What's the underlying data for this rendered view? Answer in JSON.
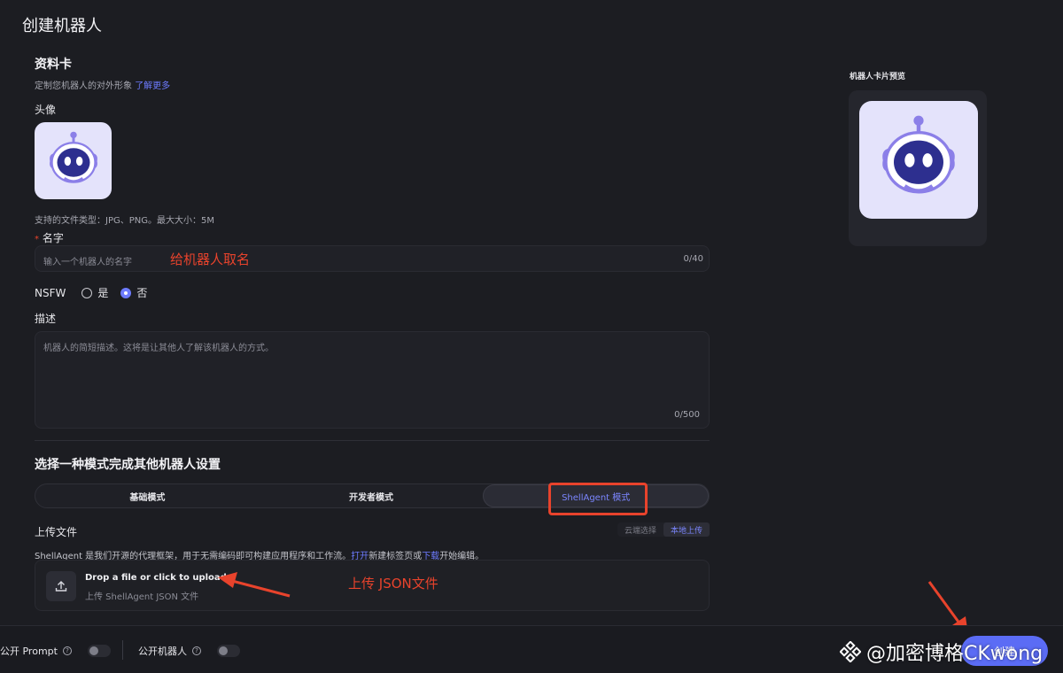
{
  "page": {
    "title": "创建机器人"
  },
  "profile": {
    "title": "资料卡",
    "subtitle": "定制您机器人的对外形象",
    "learn_more": "了解更多",
    "avatar_label": "头像",
    "file_hint": "支持的文件类型：JPG、PNG。最大大小：5M"
  },
  "name_field": {
    "required_mark": "*",
    "label": "名字",
    "placeholder": "输入一个机器人的名字",
    "counter": "0/40"
  },
  "nsfw": {
    "label": "NSFW",
    "options": [
      {
        "label": "是",
        "selected": false
      },
      {
        "label": "否",
        "selected": true
      }
    ]
  },
  "description": {
    "label": "描述",
    "placeholder": "机器人的简短描述。这将是让其他人了解该机器人的方式。",
    "counter": "0/500"
  },
  "mode": {
    "title": "选择一种模式完成其他机器人设置",
    "tabs": [
      {
        "label": "基础模式",
        "active": false
      },
      {
        "label": "开发者模式",
        "active": false
      },
      {
        "label": "ShellAgent 模式",
        "active": true
      }
    ]
  },
  "upload": {
    "label": "上传文件",
    "source_options": [
      {
        "label": "云端选择",
        "active": false
      },
      {
        "label": "本地上传",
        "active": true
      }
    ],
    "desc_prefix": "ShellAgent 是我们开源的代理框架，用于无需编码即可构建应用程序和工作流。",
    "desc_open": "打开",
    "desc_mid": "新建标签页或",
    "desc_download": "下载",
    "desc_suffix": "开始编辑。",
    "drop_title": "Drop a file or click to upload",
    "drop_sub": "上传 ShellAgent JSON 文件"
  },
  "preview": {
    "title": "机器人卡片预览"
  },
  "bottom": {
    "public_prompt": "公开 Prompt",
    "public_bot": "公开机器人",
    "help_glyph": "?",
    "create_button": "创建"
  },
  "annotations": {
    "name_hint": "给机器人取名",
    "upload_hint": "上传 JSON文件"
  },
  "watermark": {
    "text": "@加密博格CKwong"
  },
  "colors": {
    "background": "#1c1d22",
    "accent": "#6d7bff",
    "annotation_red": "#e8432c",
    "primary_button": "#5b6cf5"
  }
}
